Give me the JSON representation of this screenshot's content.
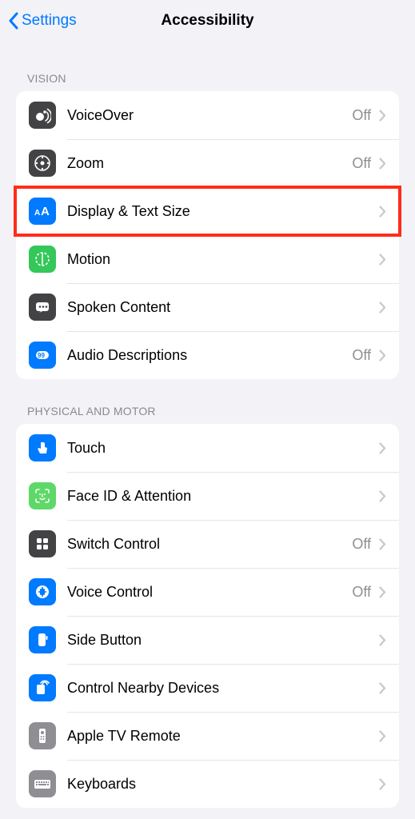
{
  "nav": {
    "back": "Settings",
    "title": "Accessibility"
  },
  "sections": [
    {
      "header": "Vision",
      "items": [
        {
          "icon": "voiceover-icon",
          "label": "VoiceOver",
          "status": "Off"
        },
        {
          "icon": "zoom-icon",
          "label": "Zoom",
          "status": "Off"
        },
        {
          "icon": "display-text-size-icon",
          "label": "Display & Text Size",
          "status": ""
        },
        {
          "icon": "motion-icon",
          "label": "Motion",
          "status": ""
        },
        {
          "icon": "spoken-content-icon",
          "label": "Spoken Content",
          "status": ""
        },
        {
          "icon": "audio-descriptions-icon",
          "label": "Audio Descriptions",
          "status": "Off"
        }
      ]
    },
    {
      "header": "Physical and Motor",
      "items": [
        {
          "icon": "touch-icon",
          "label": "Touch",
          "status": ""
        },
        {
          "icon": "faceid-attention-icon",
          "label": "Face ID & Attention",
          "status": ""
        },
        {
          "icon": "switch-control-icon",
          "label": "Switch Control",
          "status": "Off"
        },
        {
          "icon": "voice-control-icon",
          "label": "Voice Control",
          "status": "Off"
        },
        {
          "icon": "side-button-icon",
          "label": "Side Button",
          "status": ""
        },
        {
          "icon": "control-nearby-icon",
          "label": "Control Nearby Devices",
          "status": ""
        },
        {
          "icon": "apple-tv-remote-icon",
          "label": "Apple TV Remote",
          "status": ""
        },
        {
          "icon": "keyboards-icon",
          "label": "Keyboards",
          "status": ""
        }
      ]
    }
  ],
  "highlight": {
    "row_index": [
      0,
      2
    ]
  }
}
